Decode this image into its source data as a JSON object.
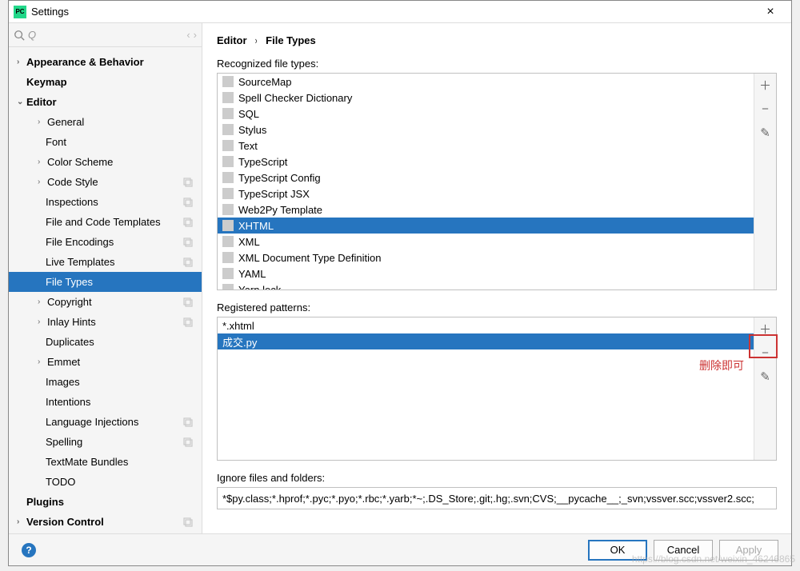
{
  "window": {
    "title": "Settings"
  },
  "search": {
    "placeholder": ""
  },
  "breadcrumb": {
    "a": "Editor",
    "b": "File Types"
  },
  "tree": {
    "appearance": "Appearance & Behavior",
    "keymap": "Keymap",
    "editor": "Editor",
    "general": "General",
    "font": "Font",
    "colorscheme": "Color Scheme",
    "codestyle": "Code Style",
    "inspections": "Inspections",
    "filecodetpl": "File and Code Templates",
    "fileenc": "File Encodings",
    "livetpl": "Live Templates",
    "filetypes": "File Types",
    "copyright": "Copyright",
    "inlay": "Inlay Hints",
    "duplicates": "Duplicates",
    "emmet": "Emmet",
    "images": "Images",
    "intentions": "Intentions",
    "langinj": "Language Injections",
    "spelling": "Spelling",
    "textmate": "TextMate Bundles",
    "todo": "TODO",
    "plugins": "Plugins",
    "versionctrl": "Version Control"
  },
  "labels": {
    "recognized": "Recognized file types:",
    "registered": "Registered patterns:",
    "ignore": "Ignore files and folders:"
  },
  "filetypes": {
    "items": [
      "SourceMap",
      "Spell Checker Dictionary",
      "SQL",
      "Stylus",
      "Text",
      "TypeScript",
      "TypeScript Config",
      "TypeScript JSX",
      "Web2Py Template",
      "XHTML",
      "XML",
      "XML Document Type Definition",
      "YAML",
      "Yarn.lock"
    ],
    "selectedIndex": 9
  },
  "patterns": {
    "items": [
      "*.xhtml",
      "成交.py"
    ],
    "selectedIndex": 1
  },
  "annotation": "删除即可",
  "ignore": {
    "value": "*$py.class;*.hprof;*.pyc;*.pyo;*.rbc;*.yarb;*~;.DS_Store;.git;.hg;.svn;CVS;__pycache__;_svn;vssver.scc;vssver2.scc;"
  },
  "footer": {
    "ok": "OK",
    "cancel": "Cancel",
    "apply": "Apply"
  },
  "watermark": "https://blog.csdn.net/weixin_46246865"
}
